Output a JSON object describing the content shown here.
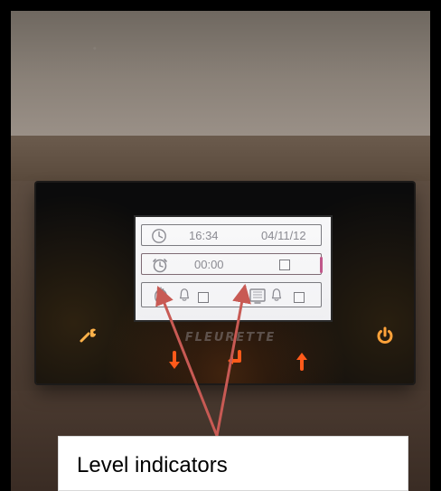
{
  "display": {
    "row1": {
      "time": "16:34",
      "date": "04/11/12"
    },
    "row2": {
      "alarm_time": "00:00"
    }
  },
  "panel": {
    "brand": "FLEURETTE"
  },
  "annotation": {
    "label": "Level indicators"
  },
  "colors": {
    "button_glow": "#ff7a1a",
    "arrow": "#c85a54"
  }
}
